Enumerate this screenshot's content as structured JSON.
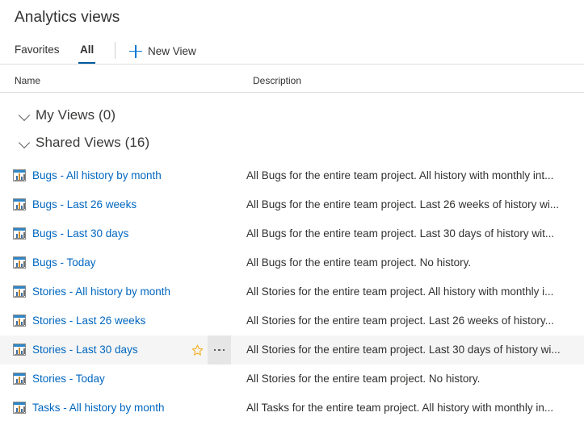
{
  "page": {
    "title": "Analytics views"
  },
  "tabs": {
    "favorites_label": "Favorites",
    "all_label": "All",
    "new_view_label": "New View",
    "accent_color": "#0078d4",
    "active_underline_color": "#005a9e"
  },
  "columns": {
    "name": "Name",
    "description": "Description"
  },
  "groups": [
    {
      "label": "My Views (0)",
      "name": "My Views",
      "count": 0,
      "expanded": true
    },
    {
      "label": "Shared Views (16)",
      "name": "Shared Views",
      "count": 16,
      "expanded": true
    }
  ],
  "rows": [
    {
      "name": "Bugs - All history by month",
      "description": "All Bugs for the entire team project. All history with monthly int...",
      "icon": "report-chart-icon",
      "hovered": false
    },
    {
      "name": "Bugs - Last 26 weeks",
      "description": "All Bugs for the entire team project. Last 26 weeks of history wi...",
      "icon": "report-chart-icon",
      "hovered": false
    },
    {
      "name": "Bugs - Last 30 days",
      "description": "All Bugs for the entire team project. Last 30 days of history wit...",
      "icon": "report-chart-icon",
      "hovered": false
    },
    {
      "name": "Bugs - Today",
      "description": "All Bugs for the entire team project. No history.",
      "icon": "report-chart-icon",
      "hovered": false
    },
    {
      "name": "Stories - All history by month",
      "description": "All Stories for the entire team project. All history with monthly i...",
      "icon": "report-chart-icon",
      "hovered": false
    },
    {
      "name": "Stories - Last 26 weeks",
      "description": "All Stories for the entire team project. Last 26 weeks of history...",
      "icon": "report-chart-icon",
      "hovered": false
    },
    {
      "name": "Stories - Last 30 days",
      "description": "All Stories for the entire team project. Last 30 days of history wi...",
      "icon": "report-chart-icon",
      "hovered": true
    },
    {
      "name": "Stories - Today",
      "description": "All Stories for the entire team project. No history.",
      "icon": "report-chart-icon",
      "hovered": false
    },
    {
      "name": "Tasks - All history by month",
      "description": "All Tasks for the entire team project. All history with monthly in...",
      "icon": "report-chart-icon",
      "hovered": false
    }
  ],
  "row_actions": {
    "favorite_icon": "star-icon",
    "more_icon": "ellipsis-icon",
    "favorite_color": "#f2b632"
  }
}
